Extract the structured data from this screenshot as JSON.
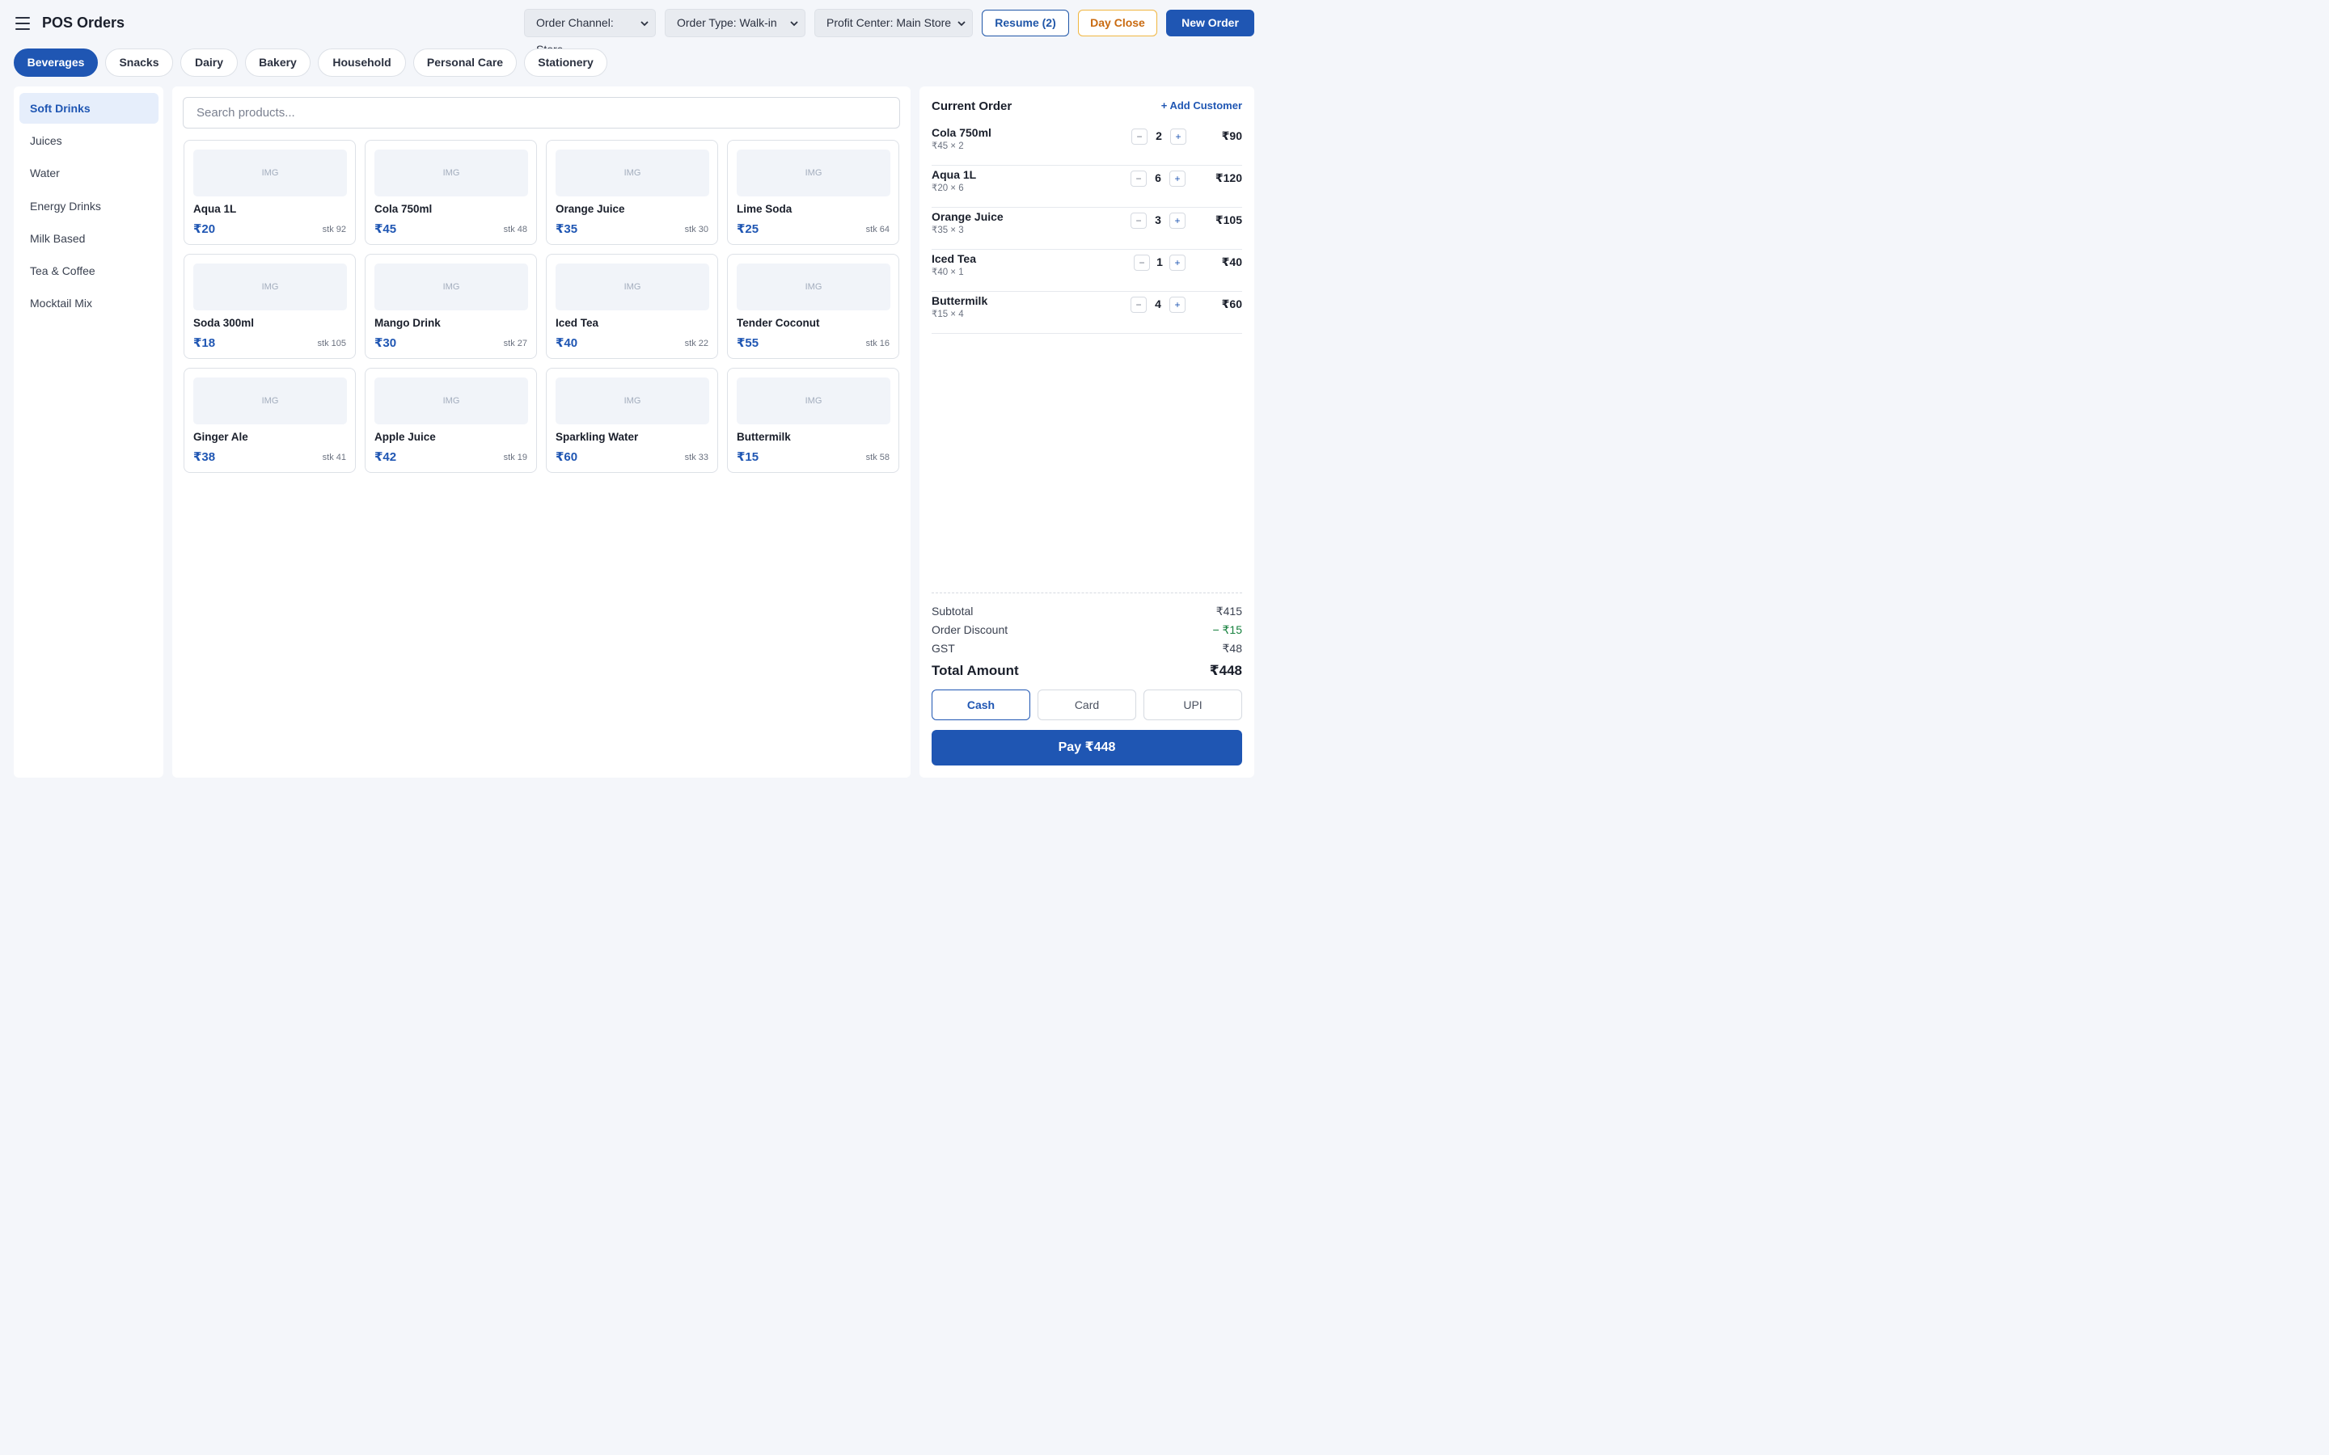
{
  "header": {
    "title": "POS Orders",
    "channel_select": "Order Channel: Store",
    "type_select": "Order Type: Walk-in",
    "profit_select": "Profit Center: Main Store",
    "resume_label": "Resume (2)",
    "day_close_label": "Day Close",
    "new_order_label": "New Order"
  },
  "categories": [
    "Beverages",
    "Snacks",
    "Dairy",
    "Bakery",
    "Household",
    "Personal Care",
    "Stationery"
  ],
  "active_category": "Beverages",
  "subcategories": [
    "Soft Drinks",
    "Juices",
    "Water",
    "Energy Drinks",
    "Milk Based",
    "Tea & Coffee",
    "Mocktail Mix"
  ],
  "active_subcategory": "Soft Drinks",
  "search": {
    "placeholder": "Search products..."
  },
  "img_placeholder": "IMG",
  "products": [
    {
      "name": "Aqua 1L",
      "price": "₹20",
      "stock": "stk 92"
    },
    {
      "name": "Cola 750ml",
      "price": "₹45",
      "stock": "stk 48"
    },
    {
      "name": "Orange Juice",
      "price": "₹35",
      "stock": "stk 30"
    },
    {
      "name": "Lime Soda",
      "price": "₹25",
      "stock": "stk 64"
    },
    {
      "name": "Soda 300ml",
      "price": "₹18",
      "stock": "stk 105"
    },
    {
      "name": "Mango Drink",
      "price": "₹30",
      "stock": "stk 27"
    },
    {
      "name": "Iced Tea",
      "price": "₹40",
      "stock": "stk 22"
    },
    {
      "name": "Tender Coconut",
      "price": "₹55",
      "stock": "stk 16"
    },
    {
      "name": "Ginger Ale",
      "price": "₹38",
      "stock": "stk 41"
    },
    {
      "name": "Apple Juice",
      "price": "₹42",
      "stock": "stk 19"
    },
    {
      "name": "Sparkling Water",
      "price": "₹60",
      "stock": "stk 33"
    },
    {
      "name": "Buttermilk",
      "price": "₹15",
      "stock": "stk 58"
    }
  ],
  "order": {
    "title": "Current Order",
    "add_customer": "+ Add Customer",
    "minus_symbol": "−",
    "plus_symbol": "+",
    "lines": [
      {
        "name": "Cola 750ml",
        "sub": "₹45 × 2",
        "qty": "2",
        "total": "₹90"
      },
      {
        "name": "Aqua 1L",
        "sub": "₹20 × 6",
        "qty": "6",
        "total": "₹120"
      },
      {
        "name": "Orange Juice",
        "sub": "₹35 × 3",
        "qty": "3",
        "total": "₹105"
      },
      {
        "name": "Iced Tea",
        "sub": "₹40 × 1",
        "qty": "1",
        "total": "₹40"
      },
      {
        "name": "Buttermilk",
        "sub": "₹15 × 4",
        "qty": "4",
        "total": "₹60"
      }
    ],
    "subtotal_label": "Subtotal",
    "subtotal": "₹415",
    "discount_label": "Order Discount",
    "discount": "− ₹15",
    "gst_label": "GST",
    "gst": "₹48",
    "total_label": "Total Amount",
    "total": "₹448",
    "payment_modes": [
      "Cash",
      "Card",
      "UPI"
    ],
    "active_payment": "Cash",
    "pay_label": "Pay ₹448"
  },
  "colors": {
    "primary": "#1f56b3",
    "warning_border": "#f0b640",
    "warning_text": "#c96a10",
    "discount": "#15803d",
    "background": "#f4f6fa"
  }
}
